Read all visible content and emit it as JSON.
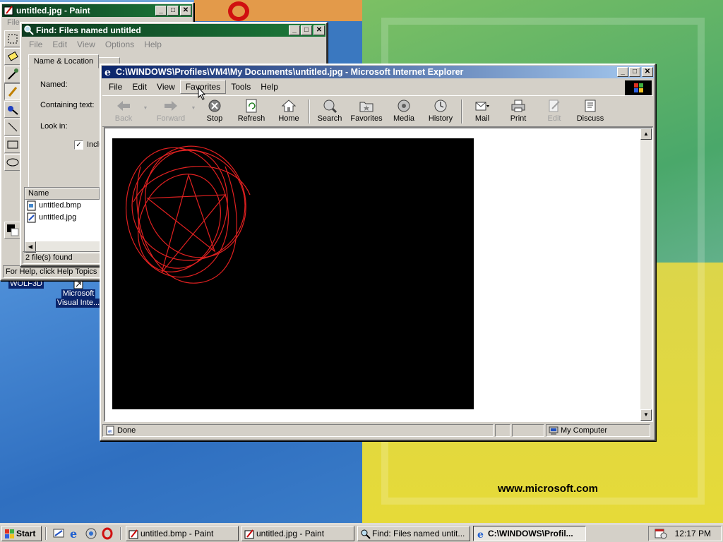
{
  "colors": {
    "title_active": "#0a246a",
    "title_inactive": "#0d3b20",
    "face": "#d4d0c8",
    "scribble": "#e02020"
  },
  "wallpaper": {
    "url_text": "www.microsoft.com"
  },
  "paint": {
    "title": "untitled.jpg - Paint",
    "menu_first": "File",
    "status": "For Help, click Help Topics on"
  },
  "find": {
    "title": "Find: Files named untitled",
    "menu": [
      "File",
      "Edit",
      "View",
      "Options",
      "Help"
    ],
    "tab": "Name & Location",
    "labels": {
      "named": "Named:",
      "containing": "Containing text:",
      "look_in": "Look in:",
      "include": "Inclu"
    },
    "list_header": "Name",
    "files": [
      "untitled.bmp",
      "untitled.jpg"
    ],
    "status": "2 file(s) found"
  },
  "ie": {
    "title": "C:\\WINDOWS\\Profiles\\VM4\\My Documents\\untitled.jpg - Microsoft Internet Explorer",
    "menu": [
      "File",
      "Edit",
      "View",
      "Favorites",
      "Tools",
      "Help"
    ],
    "toolbar": {
      "back": "Back",
      "forward": "Forward",
      "stop": "Stop",
      "refresh": "Refresh",
      "home": "Home",
      "search": "Search",
      "favorites": "Favorites",
      "media": "Media",
      "history": "History",
      "mail": "Mail",
      "print": "Print",
      "edit": "Edit",
      "discuss": "Discuss"
    },
    "status": {
      "left": "Done",
      "zone": "My Computer"
    }
  },
  "desktop_icons": [
    {
      "label1": "WOLF3D",
      "label2": ""
    },
    {
      "label1": "Microsoft",
      "label2": "Visual Inte..."
    }
  ],
  "taskbar": {
    "start": "Start",
    "tasks": [
      "untitled.bmp - Paint",
      "untitled.jpg - Paint",
      "Find: Files named untit...",
      "C:\\WINDOWS\\Profil..."
    ],
    "clock": "12:17 PM"
  }
}
